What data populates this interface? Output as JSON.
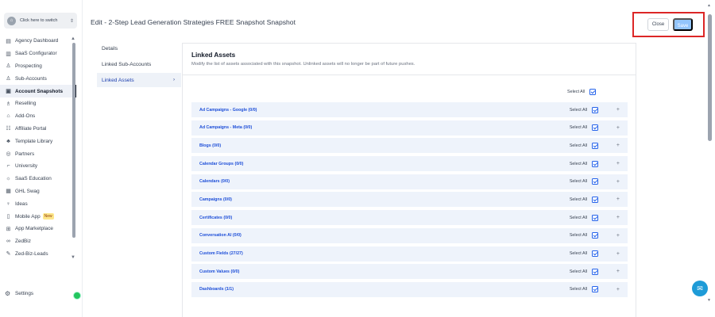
{
  "sidebar": {
    "switcher_label": "Click here to switch",
    "switcher_avatar_icon": "store-icon",
    "items": [
      {
        "label": "Agency Dashboard",
        "icon": "dashboard-icon",
        "glyph": "▤",
        "active": false
      },
      {
        "label": "SaaS Configurator",
        "icon": "chart-icon",
        "glyph": "▥",
        "active": false
      },
      {
        "label": "Prospecting",
        "icon": "users-icon",
        "glyph": "♙",
        "active": false
      },
      {
        "label": "Sub-Accounts",
        "icon": "user-icon",
        "glyph": "♙",
        "active": false
      },
      {
        "label": "Account Snapshots",
        "icon": "snapshot-icon",
        "glyph": "▣",
        "active": true
      },
      {
        "label": "Reselling",
        "icon": "reselling-icon",
        "glyph": "♗",
        "active": false
      },
      {
        "label": "Add-Ons",
        "icon": "addons-icon",
        "glyph": "⌂",
        "active": false
      },
      {
        "label": "Affiliate Portal",
        "icon": "affiliate-icon",
        "glyph": "☷",
        "active": false
      },
      {
        "label": "Template Library",
        "icon": "template-icon",
        "glyph": "♣",
        "active": false
      },
      {
        "label": "Partners",
        "icon": "handshake-icon",
        "glyph": "◎",
        "active": false
      },
      {
        "label": "University",
        "icon": "graduation-cap-icon",
        "glyph": "⌐",
        "active": false
      },
      {
        "label": "SaaS Education",
        "icon": "saas-education-icon",
        "glyph": "☼",
        "active": false
      },
      {
        "label": "GHL Swag",
        "icon": "swag-icon",
        "glyph": "▦",
        "active": false
      },
      {
        "label": "Ideas",
        "icon": "lightbulb-icon",
        "glyph": "♀",
        "active": false
      },
      {
        "label": "Mobile App",
        "icon": "mobile-icon",
        "glyph": "▯",
        "active": false,
        "badge": "New"
      },
      {
        "label": "App Marketplace",
        "icon": "marketplace-icon",
        "glyph": "⊞",
        "active": false
      },
      {
        "label": "ZedBiz",
        "icon": "link-icon",
        "glyph": "∞",
        "active": false
      },
      {
        "label": "Zed-Biz-Leads",
        "icon": "wrench-icon",
        "glyph": "✎",
        "active": false
      }
    ],
    "settings_label": "Settings"
  },
  "header": {
    "title": "Edit - 2-Step Lead Generation Strategies FREE Snapshot Snapshot",
    "close_label": "Close",
    "save_label": "Save"
  },
  "subnav": {
    "items": [
      {
        "label": "Details",
        "active": false
      },
      {
        "label": "Linked Sub-Accounts",
        "active": false
      },
      {
        "label": "Linked Assets",
        "active": true
      }
    ]
  },
  "linked_assets": {
    "title": "Linked Assets",
    "subtitle": "Modify the list of assets associated with this snapshot. Unlinked assets will no longer be part of future pushes.",
    "select_all_label": "Select All",
    "rows": [
      {
        "name": "Ad Campaigns - Google (0/0)"
      },
      {
        "name": "Ad Campaigns - Meta (0/0)"
      },
      {
        "name": "Blogs (0/0)"
      },
      {
        "name": "Calendar Groups (0/0)"
      },
      {
        "name": "Calendars (0/0)"
      },
      {
        "name": "Campaigns (0/0)"
      },
      {
        "name": "Certificates (0/0)"
      },
      {
        "name": "Conversation AI (0/0)"
      },
      {
        "name": "Custom Fields (27/27)"
      },
      {
        "name": "Custom Values (0/0)"
      },
      {
        "name": "Dashboards (1/1)"
      }
    ],
    "plus_glyph": "+"
  }
}
